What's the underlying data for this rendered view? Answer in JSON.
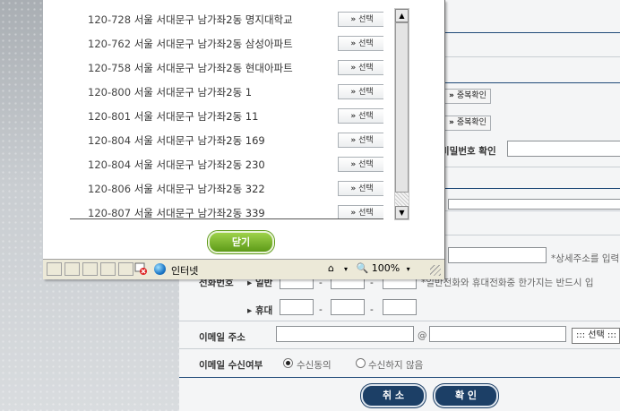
{
  "popup": {
    "rows": [
      {
        "zip": "120-728",
        "address": "서울 서대문구 남가좌2동 명지대학교",
        "button": "선택"
      },
      {
        "zip": "120-762",
        "address": "서울 서대문구 남가좌2동 삼성아파트",
        "button": "선택"
      },
      {
        "zip": "120-758",
        "address": "서울 서대문구 남가좌2동 현대아파트",
        "button": "선택"
      },
      {
        "zip": "120-800",
        "address": "서울 서대문구 남가좌2동 1",
        "button": "선택"
      },
      {
        "zip": "120-801",
        "address": "서울 서대문구 남가좌2동 11",
        "button": "선택"
      },
      {
        "zip": "120-804",
        "address": "서울 서대문구 남가좌2동 169",
        "button": "선택"
      },
      {
        "zip": "120-804",
        "address": "서울 서대문구 남가좌2동 230",
        "button": "선택"
      },
      {
        "zip": "120-806",
        "address": "서울 서대문구 남가좌2동 322",
        "button": "선택"
      },
      {
        "zip": "120-807",
        "address": "서울 서대문구 남가좌2동 339",
        "button": "선택"
      }
    ],
    "button_prefix": "»",
    "close_label": "닫기",
    "status": {
      "zone": "인터넷",
      "zoom": "100%"
    }
  },
  "form": {
    "dup_check_label": "중복확인",
    "password_confirm_label": "비밀번호 확인",
    "detail_address_hint": "*상세주소를 입력",
    "phone_label": "전화번호",
    "home_label": "일반",
    "mobile_label": "휴대",
    "phone_hint": "*일반전화와 휴대전화중 한가지는 반드시 입",
    "email_label": "이메일 주소",
    "email_at": "@",
    "email_select": "::: 선택 :::",
    "email_consent_label": "이메일 수신여부",
    "consent_yes": "수신동의",
    "consent_no": "수신하지 않음",
    "cancel_label": "취 소",
    "confirm_label": "확 인"
  },
  "colors": {
    "navy": "#1c3f66",
    "green": "#6fae22"
  }
}
